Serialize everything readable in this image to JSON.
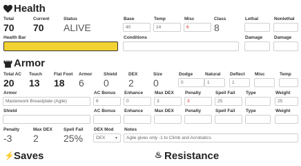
{
  "health": {
    "title": "Health",
    "total_label": "Total",
    "total_value": "70",
    "current_label": "Current",
    "current_value": "70",
    "status_label": "Status",
    "status_value": "ALIVE",
    "base_label": "Base",
    "base_value": "40",
    "temp_label": "Temp",
    "temp_value": "14",
    "misc_label": "Misc",
    "misc_value": "6",
    "class_label": "Class",
    "class_value": "8",
    "lethal_label": "Lethal",
    "lethal_value": "",
    "nonlethal_label": "Nonlethal",
    "nonlethal_value": "",
    "bar_label": "Health Bar",
    "bar_fill": 1.0,
    "bar_color": "#f2d230",
    "conditions_label": "Conditions",
    "conditions_value": "",
    "damage_label": "Damage",
    "damage_value": "",
    "damage2_label": "Damage",
    "damage2_value": ""
  },
  "armor": {
    "title": "Armor",
    "total_ac_label": "Total AC",
    "total_ac_value": "20",
    "touch_label": "Touch",
    "touch_value": "13",
    "flat_foot_label": "Flat Foot",
    "flat_foot_value": "18",
    "armor_label": "Armor",
    "armor_value": "6",
    "shield_label": "Shield",
    "shield_value": "0",
    "dex_label": "DEX",
    "dex_value": "2",
    "size_label": "Size",
    "size_value": "0",
    "dodge_label": "Dodge",
    "dodge_value": "0",
    "natural_label": "Natural",
    "natural_value": "1",
    "deflect_label": "Deflect",
    "deflect_value": "1",
    "misc_label": "Misc",
    "misc_value": "",
    "temp_label": "Temp",
    "temp_value": "",
    "armor_item": {
      "label": "Armor",
      "value": "Masterwork Breastplate (Agile)",
      "ac_bonus_label": "AC Bonus",
      "ac_bonus_value": "6",
      "enhance_label": "Enhance",
      "enhance_value": "0",
      "max_dex_label": "Max DEX",
      "max_dex_value": "3",
      "penalty_label": "Penalty",
      "penalty_value": "3",
      "spell_fail_label": "Spell Fail",
      "spell_fail_value": "25",
      "type_label": "Type",
      "type_value": "",
      "weight_label": "Weight",
      "weight_value": "25"
    },
    "shield_item": {
      "label": "Shield",
      "value": "",
      "ac_bonus_label": "AC Bonus",
      "ac_bonus_value": "",
      "enhance_label": "Enhance",
      "enhance_value": "",
      "max_dex_label": "Max DEX",
      "max_dex_value": "",
      "penalty_label": "Penalty",
      "penalty_value": "",
      "spell_fail_label": "Spell Fail",
      "spell_fail_value": "",
      "type_label": "Type",
      "type_value": "",
      "weight_label": "Weight",
      "weight_value": ""
    },
    "totals": {
      "penalty_label": "Penalty",
      "penalty_value": "-3",
      "max_dex_label": "Max DEX",
      "max_dex_value": "2",
      "spell_fail_label": "Spell Fail",
      "spell_fail_value": "25%",
      "dex_mod_label": "DEX Mod",
      "dex_mod_value": "DEX",
      "notes_label": "Notes",
      "notes_value": "Agile gives only -1 to Climb and Acrobatics"
    }
  },
  "saves": {
    "title": "Saves"
  },
  "resistance": {
    "title": "Resistance"
  }
}
